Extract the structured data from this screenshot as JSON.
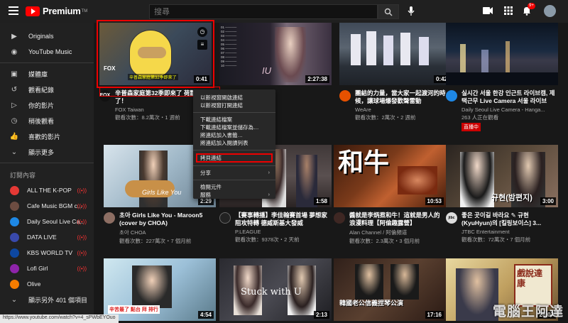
{
  "header": {
    "logo_text": "Premium",
    "logo_tm": "TM",
    "search_placeholder": "搜尋",
    "notification_count": "9+"
  },
  "sidebar": {
    "items": [
      {
        "label": "Originals",
        "icon": "originals-icon"
      },
      {
        "label": "YouTube Music",
        "icon": "music-icon"
      },
      {
        "label": "媒體庫",
        "icon": "library-icon"
      },
      {
        "label": "觀看紀錄",
        "icon": "history-icon"
      },
      {
        "label": "你的影片",
        "icon": "your-videos-icon"
      },
      {
        "label": "稍後觀看",
        "icon": "watch-later-icon"
      },
      {
        "label": "喜歡的影片",
        "icon": "liked-icon"
      },
      {
        "label": "顯示更多",
        "icon": "chevron-down-icon"
      }
    ],
    "subscriptions_heading": "訂閱內容",
    "channels": [
      {
        "name": "ALL THE K-POP",
        "color": "#e53935",
        "live": true
      },
      {
        "name": "Cafe Music BGM c...",
        "color": "#6d4c41",
        "live": true
      },
      {
        "name": "Daily Seoul Live Ca...",
        "color": "#1e88e5",
        "live": true
      },
      {
        "name": "DATA LIVE",
        "color": "#3949ab",
        "live": true
      },
      {
        "name": "KBS WORLD TV",
        "color": "#0d47a1",
        "live": true
      },
      {
        "name": "Lofi Girl",
        "color": "#8e24aa",
        "live": true
      },
      {
        "name": "Olive",
        "color": "#f57c00",
        "live": false
      }
    ],
    "show_more_channels": "顯示另外 401 個項目"
  },
  "videos": [
    {
      "title": "辛普森家庭第32季即來了 荷默要來了！",
      "channel": "FOX Taiwan",
      "stats": "觀看次數：8.2萬次・1 週前",
      "duration": "0:41",
      "av": "#111"
    },
    {
      "title": "[Playlist] IU 아이유 Best Songs - IU 最佳歌曲 - IU 최고의...",
      "channel": "",
      "stats": "",
      "duration": "2:27:38",
      "av": "#555"
    },
    {
      "title": "團結的力量，當大家一起渡河的時候，讓球場爆發歡聲雷動",
      "channel": "WeAre",
      "stats": "觀看次數：2萬次・2 週前",
      "duration": "0:42",
      "av": "#e65100"
    },
    {
      "title": "실시간 서울 한강 인근트 라이브캠, 제택근무 Live Camera 서울 라이브",
      "channel": "Daily Seoul Live Camera - Hanga...",
      "stats": "263 人正在觀看",
      "duration": "",
      "live": "直播中",
      "av": "#1e88e5"
    },
    {
      "title": "초아 Girls Like You - Maroon5 (cover by CHOA)",
      "channel": "초아 CHOA",
      "stats": "觀看次數：227萬次・7 個月前",
      "duration": "2:29",
      "av": "#8d6e63"
    },
    {
      "title": "【賽事轉播】李佳翰賽首場 夢想家阻攻特轉 德威斯基大發威",
      "channel": "P.LEAGUE",
      "stats": "觀看次數：9378次・2 天前",
      "duration": "1:58",
      "av": "#222"
    },
    {
      "title": "醬就是李炳焄和牛！這就是男人的浪漫料理【阿倫趣露營】",
      "channel": "Alan Channel / 阿倫頻道",
      "stats": "觀看次數：2.3萬次・3 個月前",
      "duration": "10:53",
      "av": "#3e2723"
    },
    {
      "title": "좋은 곳이길 바라요 ✎ 규현 (KyuHyun)의 [킬링보이스] 3...",
      "channel": "JTBC Entertainment",
      "stats": "觀看次數：72萬次・7 個月前",
      "duration": "3:00",
      "av": "#ddd"
    },
    {
      "title": "",
      "channel": "",
      "stats": "",
      "duration": "4:54",
      "av": "#666"
    },
    {
      "title": "",
      "channel": "",
      "stats": "",
      "duration": "2:13",
      "av": "#666"
    },
    {
      "title": "",
      "channel": "",
      "stats": "",
      "duration": "17:16",
      "av": "#666"
    },
    {
      "title": "",
      "channel": "",
      "stats": "",
      "duration": "26:07",
      "av": "#666"
    }
  ],
  "thumb_texts": {
    "v1_caption": "辛普森家庭第32季即來了",
    "v1_brand": "FOX",
    "v2_text": "IU",
    "v6_text": "和牛",
    "v7_text": "규현(밤편지)",
    "v5_text": "Girls Like You",
    "v9_text": "Stuck with U",
    "v10_text": "韓國老公信義捏琴公演",
    "v11_text": "戲說達康",
    "v8_text": "辛苦最了 點台 拜 排行"
  },
  "context_menu": {
    "items_group1": [
      "以新視窗開啟連結",
      "以新視窗打開連結"
    ],
    "items_group2": [
      "下載連結檔案",
      "下載連結檔案並儲存為…",
      "將連結加入書籤…",
      "將連結加入閱讀列表"
    ],
    "copy_link": "拷貝連結",
    "share": "分享",
    "items_group3": [
      "檢閱元件",
      "服務"
    ]
  },
  "status_url": "https://www.youtube.com/watch?v=4_sPWbEYOuo",
  "watermark": "電腦王阿達"
}
